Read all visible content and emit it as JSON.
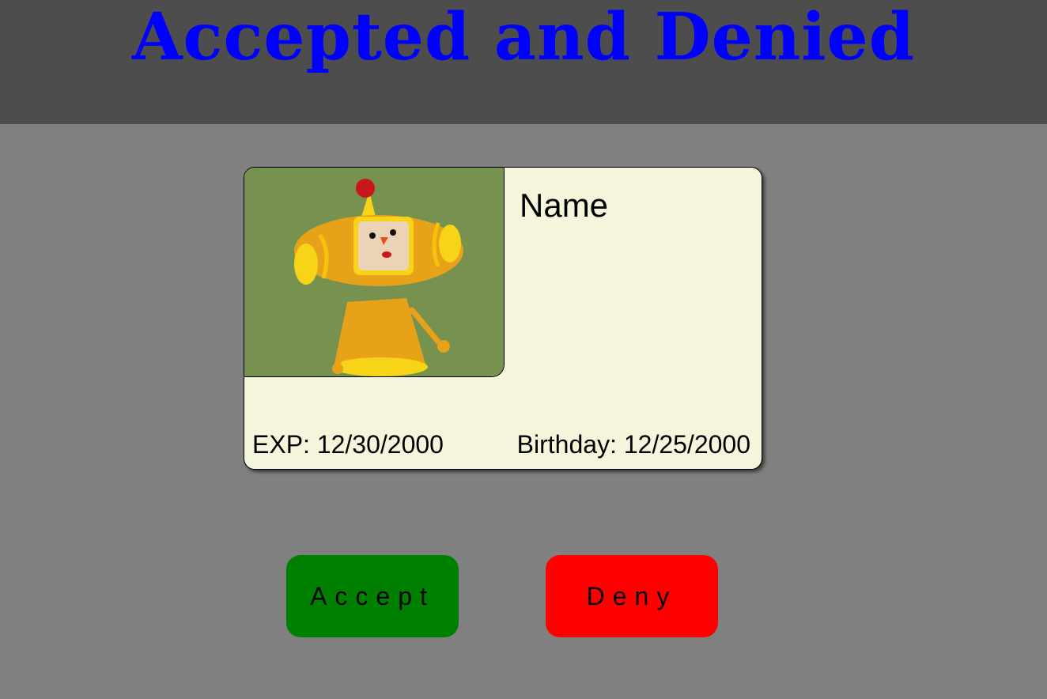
{
  "page": {
    "title": "Accepted and Denied"
  },
  "card": {
    "name": "Name",
    "exp": "EXP: 12/30/2000",
    "birthday": "Birthday: 12/25/2000",
    "photo_icon": "character-portrait"
  },
  "actions": {
    "accept_label": "Accept",
    "deny_label": "Deny"
  },
  "colors": {
    "header_bg": "#4d4d4d",
    "page_bg": "#808080",
    "title": "#0000ff",
    "card_bg": "#f5f5dc",
    "photo_bg": "#77924f",
    "accept": "#008000",
    "deny": "#ff0000"
  }
}
